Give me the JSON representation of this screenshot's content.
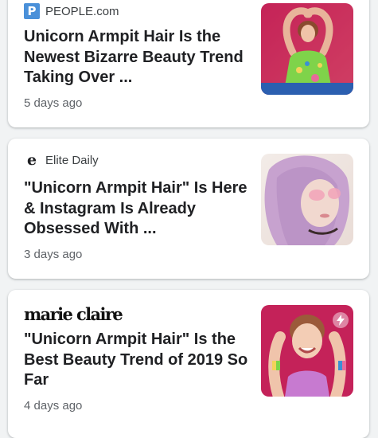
{
  "feed": {
    "articles": [
      {
        "source": "PEOPLE.com",
        "logo_icon": "people-logo-icon",
        "logo_text": "P",
        "headline": "Unicorn Armpit Hair Is the Newest Bizarre Beauty Trend Taking Over ...",
        "age": "5 days ago",
        "thumbnail": "woman-arms-raised-green-top-image"
      },
      {
        "source": "Elite Daily",
        "logo_icon": "elite-daily-logo-icon",
        "logo_text": "e",
        "headline": "\"Unicorn Armpit Hair\" Is Here & Instagram Is Already Obsessed With ...",
        "age": "3 days ago",
        "thumbnail": "woman-lavender-hair-sunglasses-image"
      },
      {
        "source": "marie claire",
        "logo_icon": "marie-claire-logo",
        "headline": "\"Unicorn Armpit Hair\" Is the Best Beauty Trend of 2019 So Far",
        "age": "4 days ago",
        "thumbnail": "woman-smiling-rainbow-armpit-image",
        "badge_icon": "amp-lightning-icon"
      }
    ]
  },
  "colors": {
    "background": "#f1f3f4",
    "card": "#ffffff",
    "headline": "#202124",
    "meta": "#5f6368",
    "people_brand": "#4a90d9"
  }
}
